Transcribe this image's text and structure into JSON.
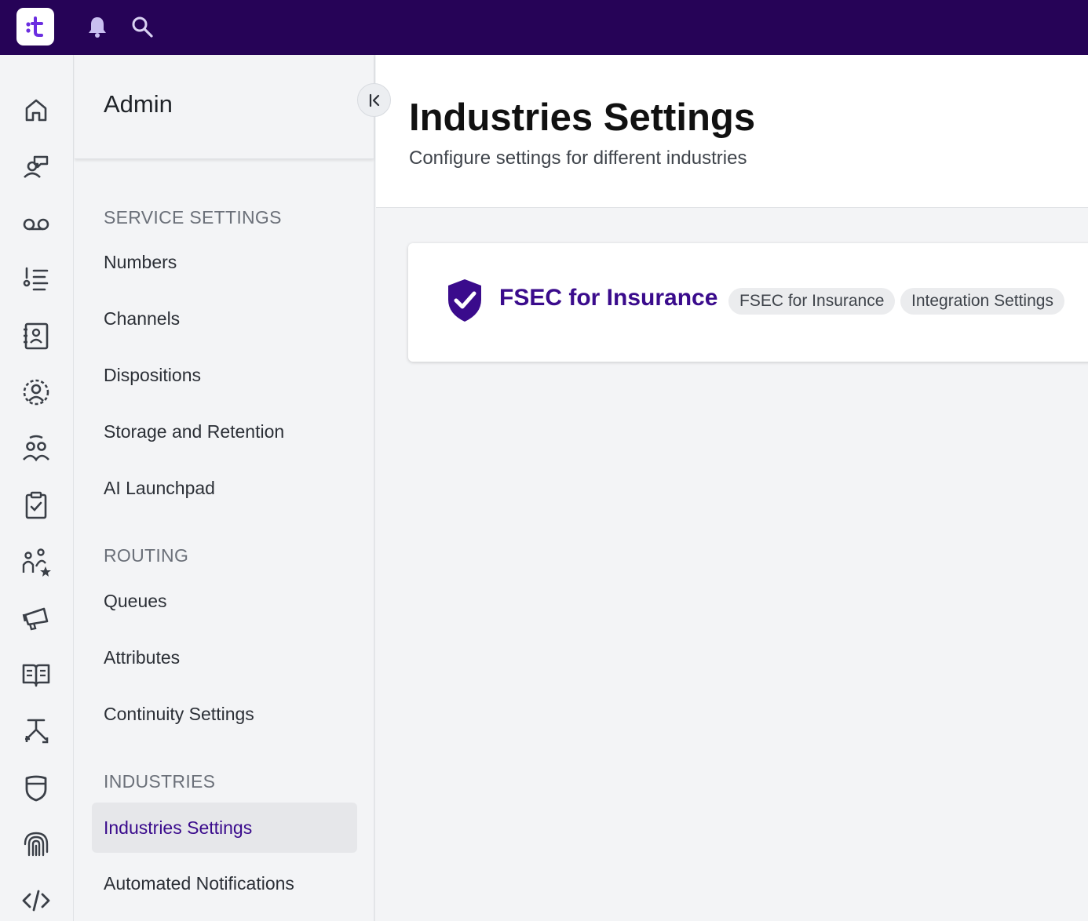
{
  "topbar": {
    "logo_text": ":t",
    "icons": [
      "bell-icon",
      "search-icon"
    ],
    "background": "#260357"
  },
  "rail": {
    "items": [
      {
        "icon": "home-icon"
      },
      {
        "icon": "agent-chat-icon"
      },
      {
        "icon": "voicemail-icon"
      },
      {
        "icon": "ordered-list-icon"
      },
      {
        "icon": "contacts-book-icon"
      },
      {
        "icon": "user-circle-icon"
      },
      {
        "icon": "team-icon"
      },
      {
        "icon": "clipboard-check-icon"
      },
      {
        "icon": "users-star-icon"
      },
      {
        "icon": "megaphone-icon"
      },
      {
        "icon": "book-open-icon"
      },
      {
        "icon": "routing-flow-icon"
      },
      {
        "icon": "shield-icon"
      },
      {
        "icon": "fingerprint-icon"
      },
      {
        "icon": "code-icon"
      }
    ]
  },
  "nav": {
    "title": "Admin",
    "sections": [
      {
        "label": "SERVICE SETTINGS",
        "items": [
          "Numbers",
          "Channels",
          "Dispositions",
          "Storage and Retention",
          "AI Launchpad"
        ]
      },
      {
        "label": "ROUTING",
        "items": [
          "Queues",
          "Attributes",
          "Continuity Settings"
        ]
      },
      {
        "label": "INDUSTRIES",
        "items": [
          "Industries Settings",
          "Automated Notifications"
        ]
      }
    ],
    "active_item": "Industries Settings"
  },
  "main": {
    "title": "Industries Settings",
    "subtitle": "Configure settings for different industries",
    "card": {
      "icon": "shield-check-icon",
      "title": "FSEC for Insurance",
      "chips": [
        "FSEC for Insurance",
        "Integration Settings"
      ]
    }
  },
  "colors": {
    "brand": "#260357",
    "accent": "#3a0b8c",
    "background": "#f3f4f6"
  }
}
